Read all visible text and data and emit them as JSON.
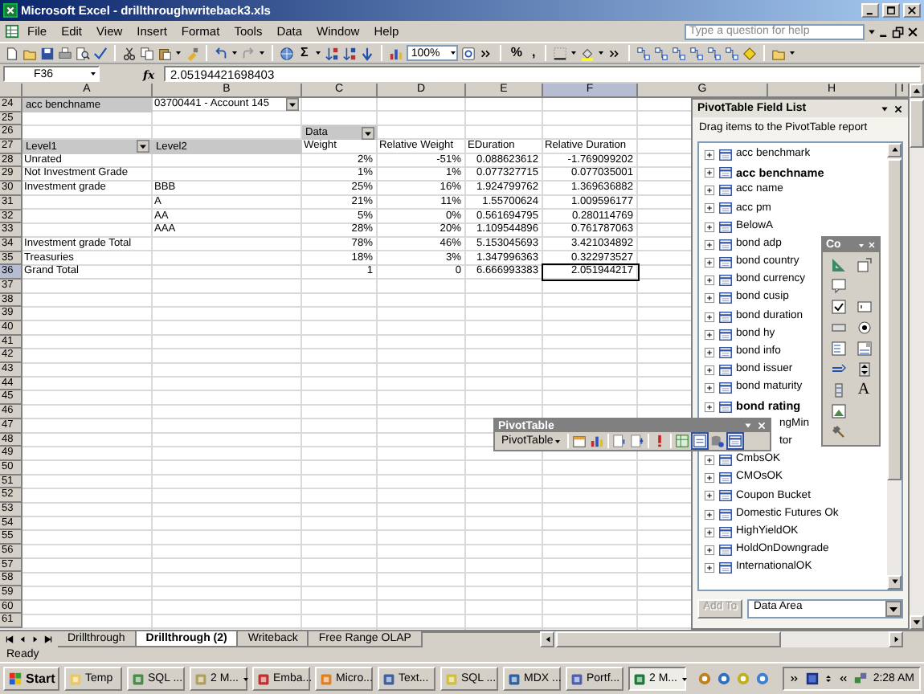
{
  "window": {
    "title": "Microsoft Excel - drillthroughwriteback3.xls"
  },
  "menu": [
    "File",
    "Edit",
    "View",
    "Insert",
    "Format",
    "Tools",
    "Data",
    "Window",
    "Help"
  ],
  "help_box": {
    "placeholder": "Type a question for help"
  },
  "toolbar": {
    "sum": "Σ",
    "zoom": "100%",
    "percent": "%",
    "comma": ","
  },
  "formula_bar": {
    "name_box": "F36",
    "fx": "fx",
    "value": "2.05194421698403"
  },
  "columns": [
    {
      "label": "A",
      "selected": false
    },
    {
      "label": "B",
      "selected": false
    },
    {
      "label": "C",
      "selected": false
    },
    {
      "label": "D",
      "selected": false
    },
    {
      "label": "E",
      "selected": false
    },
    {
      "label": "F",
      "selected": true
    },
    {
      "label": "G",
      "selected": false
    },
    {
      "label": "H",
      "selected": false
    },
    {
      "label": "I",
      "selected": false
    }
  ],
  "rows": [
    {
      "number": "24",
      "selected": false,
      "cells": [
        {
          "kind": "field",
          "text": "acc benchname",
          "dropdown": false
        },
        {
          "kind": "page_value",
          "text": "03700441 - Account 145",
          "dropdown": true
        }
      ]
    },
    {
      "number": "25",
      "selected": false
    },
    {
      "number": "26",
      "selected": false,
      "cells": [
        {
          "kind": "empty"
        },
        {
          "kind": "empty"
        },
        {
          "kind": "field",
          "text": "Data",
          "dropdown": true
        }
      ]
    },
    {
      "number": "27",
      "selected": false,
      "cells": [
        {
          "kind": "field",
          "text": "Level1",
          "dropdown": true
        },
        {
          "kind": "field",
          "text": "Level2",
          "dropdown": false
        },
        {
          "kind": "label",
          "text": "Weight"
        },
        {
          "kind": "label",
          "text": "Relative Weight"
        },
        {
          "kind": "label",
          "text": "EDuration"
        },
        {
          "kind": "label",
          "text": "Relative Duration"
        }
      ]
    },
    {
      "number": "28",
      "selected": false,
      "cells": [
        {
          "kind": "label",
          "text": "Unrated"
        },
        {
          "kind": "continuation"
        },
        {
          "kind": "number",
          "text": "2%"
        },
        {
          "kind": "number",
          "text": "-51%"
        },
        {
          "kind": "number",
          "text": "0.088623612"
        },
        {
          "kind": "number",
          "text": "-1.769099202"
        }
      ]
    },
    {
      "number": "29",
      "selected": false,
      "cells": [
        {
          "kind": "label",
          "text": "Not Investment Grade"
        },
        {
          "kind": "continuation"
        },
        {
          "kind": "number",
          "text": "1%"
        },
        {
          "kind": "number",
          "text": "1%"
        },
        {
          "kind": "number",
          "text": "0.077327715"
        },
        {
          "kind": "number",
          "text": "0.077035001"
        }
      ]
    },
    {
      "number": "30",
      "selected": false,
      "cells": [
        {
          "kind": "label",
          "text": "Investment grade"
        },
        {
          "kind": "label",
          "text": "BBB"
        },
        {
          "kind": "number",
          "text": "25%"
        },
        {
          "kind": "number",
          "text": "16%"
        },
        {
          "kind": "number",
          "text": "1.924799762"
        },
        {
          "kind": "number",
          "text": "1.369636882"
        }
      ]
    },
    {
      "number": "31",
      "selected": false,
      "cells": [
        {
          "kind": "blank"
        },
        {
          "kind": "label",
          "text": "A"
        },
        {
          "kind": "number",
          "text": "21%"
        },
        {
          "kind": "number",
          "text": "11%"
        },
        {
          "kind": "number",
          "text": "1.55700624"
        },
        {
          "kind": "number",
          "text": "1.009596177"
        }
      ]
    },
    {
      "number": "32",
      "selected": false,
      "cells": [
        {
          "kind": "blank"
        },
        {
          "kind": "label",
          "text": "AA"
        },
        {
          "kind": "number",
          "text": "5%"
        },
        {
          "kind": "number",
          "text": "0%"
        },
        {
          "kind": "number",
          "text": "0.561694795"
        },
        {
          "kind": "number",
          "text": "0.280114769"
        }
      ]
    },
    {
      "number": "33",
      "selected": false,
      "cells": [
        {
          "kind": "blank"
        },
        {
          "kind": "label",
          "text": "AAA"
        },
        {
          "kind": "number",
          "text": "28%"
        },
        {
          "kind": "number",
          "text": "20%"
        },
        {
          "kind": "number",
          "text": "1.109544896"
        },
        {
          "kind": "number",
          "text": "0.761787063"
        }
      ]
    },
    {
      "number": "34",
      "selected": false,
      "cells": [
        {
          "kind": "label",
          "text": "Investment grade Total"
        },
        {
          "kind": "continuation"
        },
        {
          "kind": "number",
          "text": "78%"
        },
        {
          "kind": "number",
          "text": "46%"
        },
        {
          "kind": "number",
          "text": "5.153045693"
        },
        {
          "kind": "number",
          "text": "3.421034892"
        }
      ]
    },
    {
      "number": "35",
      "selected": false,
      "cells": [
        {
          "kind": "label",
          "text": "Treasuries"
        },
        {
          "kind": "continuation"
        },
        {
          "kind": "number",
          "text": "18%"
        },
        {
          "kind": "number",
          "text": "3%"
        },
        {
          "kind": "number",
          "text": "1.347996363"
        },
        {
          "kind": "number",
          "text": "0.322973527"
        }
      ]
    },
    {
      "number": "36",
      "selected": true,
      "cells": [
        {
          "kind": "label",
          "text": "Grand Total"
        },
        {
          "kind": "continuation"
        },
        {
          "kind": "number",
          "text": "1"
        },
        {
          "kind": "number",
          "text": "0"
        },
        {
          "kind": "number",
          "text": "6.666993383"
        },
        {
          "kind": "number",
          "text": "2.051944217"
        }
      ]
    },
    {
      "number": "37",
      "selected": false
    },
    {
      "number": "38",
      "selected": false
    },
    {
      "number": "39",
      "selected": false
    },
    {
      "number": "40",
      "selected": false
    },
    {
      "number": "41",
      "selected": false
    },
    {
      "number": "42",
      "selected": false
    },
    {
      "number": "43",
      "selected": false
    },
    {
      "number": "44",
      "selected": false
    },
    {
      "number": "45",
      "selected": false
    },
    {
      "number": "46",
      "selected": false
    },
    {
      "number": "47",
      "selected": false
    },
    {
      "number": "48",
      "selected": false
    },
    {
      "number": "49",
      "selected": false
    },
    {
      "number": "50",
      "selected": false
    },
    {
      "number": "51",
      "selected": false
    },
    {
      "number": "52",
      "selected": false
    },
    {
      "number": "53",
      "selected": false
    },
    {
      "number": "54",
      "selected": false
    },
    {
      "number": "55",
      "selected": false
    },
    {
      "number": "56",
      "selected": false
    },
    {
      "number": "57",
      "selected": false
    },
    {
      "number": "58",
      "selected": false
    },
    {
      "number": "59",
      "selected": false
    },
    {
      "number": "60",
      "selected": false
    },
    {
      "number": "61",
      "selected": false
    }
  ],
  "field_list": {
    "title": "PivotTable Field List",
    "hint": "Drag items to the PivotTable report",
    "fields": [
      {
        "kind": "field",
        "label": "acc benchmark",
        "in_report": false
      },
      {
        "kind": "field",
        "label": "acc benchname",
        "in_report": true
      },
      {
        "kind": "field",
        "label": "acc name",
        "in_report": false
      },
      {
        "kind": "field",
        "label": "acc pm",
        "in_report": false
      },
      {
        "kind": "field",
        "label": "BelowA",
        "in_report": false
      },
      {
        "kind": "field",
        "label": "bond adp",
        "in_report": false
      },
      {
        "kind": "field",
        "label": "bond country",
        "in_report": false
      },
      {
        "kind": "field",
        "label": "bond currency",
        "in_report": false
      },
      {
        "kind": "field",
        "label": "bond cusip",
        "in_report": false
      },
      {
        "kind": "field",
        "label": "bond duration",
        "in_report": false
      },
      {
        "kind": "field",
        "label": "bond hy",
        "in_report": false
      },
      {
        "kind": "field",
        "label": "bond info",
        "in_report": false
      },
      {
        "kind": "field",
        "label": "bond issuer",
        "in_report": false
      },
      {
        "kind": "field",
        "label": "bond maturity",
        "in_report": false
      },
      {
        "kind": "field",
        "label": "bond rating",
        "in_report": true
      },
      {
        "kind": "clipped",
        "label": "ngMin",
        "in_report": false
      },
      {
        "kind": "clipped",
        "label": "tor",
        "in_report": false
      },
      {
        "kind": "field",
        "label": "CmbsOK",
        "in_report": false
      },
      {
        "kind": "field",
        "label": "CMOsOK",
        "in_report": false
      },
      {
        "kind": "field",
        "label": "Coupon Bucket",
        "in_report": false
      },
      {
        "kind": "field",
        "label": "Domestic Futures Ok",
        "in_report": false
      },
      {
        "kind": "field",
        "label": "HighYieldOK",
        "in_report": false
      },
      {
        "kind": "field",
        "label": "HoldOnDowngrade",
        "in_report": false
      },
      {
        "kind": "field",
        "label": "InternationalOK",
        "in_report": false
      }
    ],
    "add_button": {
      "label": "Add To",
      "disabled": true
    },
    "area": {
      "value": "Data Area"
    }
  },
  "pivot_toolbar": {
    "title": "PivotTable",
    "menu": "PivotTable"
  },
  "control_toolbar": {
    "title": "Co",
    "label_tool": "A"
  },
  "sheet_tabs": [
    {
      "label": "Drillthrough",
      "selected": false
    },
    {
      "label": "Drillthrough (2)",
      "selected": true
    },
    {
      "label": "Writeback",
      "selected": false
    },
    {
      "label": "Free Range OLAP",
      "selected": false
    }
  ],
  "status_bar": {
    "text": "Ready"
  },
  "taskbar": {
    "start": "Start",
    "buttons": [
      {
        "label": "Temp",
        "selected": false,
        "group": false
      },
      {
        "label": "SQL ...",
        "selected": false,
        "group": false
      },
      {
        "label": "2 M...",
        "selected": false,
        "group": true
      },
      {
        "label": "Emba...",
        "selected": false,
        "group": false
      },
      {
        "label": "Micro...",
        "selected": false,
        "group": false
      },
      {
        "label": "Text...",
        "selected": false,
        "group": false
      },
      {
        "label": "SQL ...",
        "selected": false,
        "group": false
      },
      {
        "label": "MDX ...",
        "selected": false,
        "group": false
      },
      {
        "label": "Portf...",
        "selected": false,
        "group": false
      },
      {
        "label": "2 M...",
        "selected": true,
        "group": true
      }
    ],
    "clock": "2:28 AM"
  }
}
